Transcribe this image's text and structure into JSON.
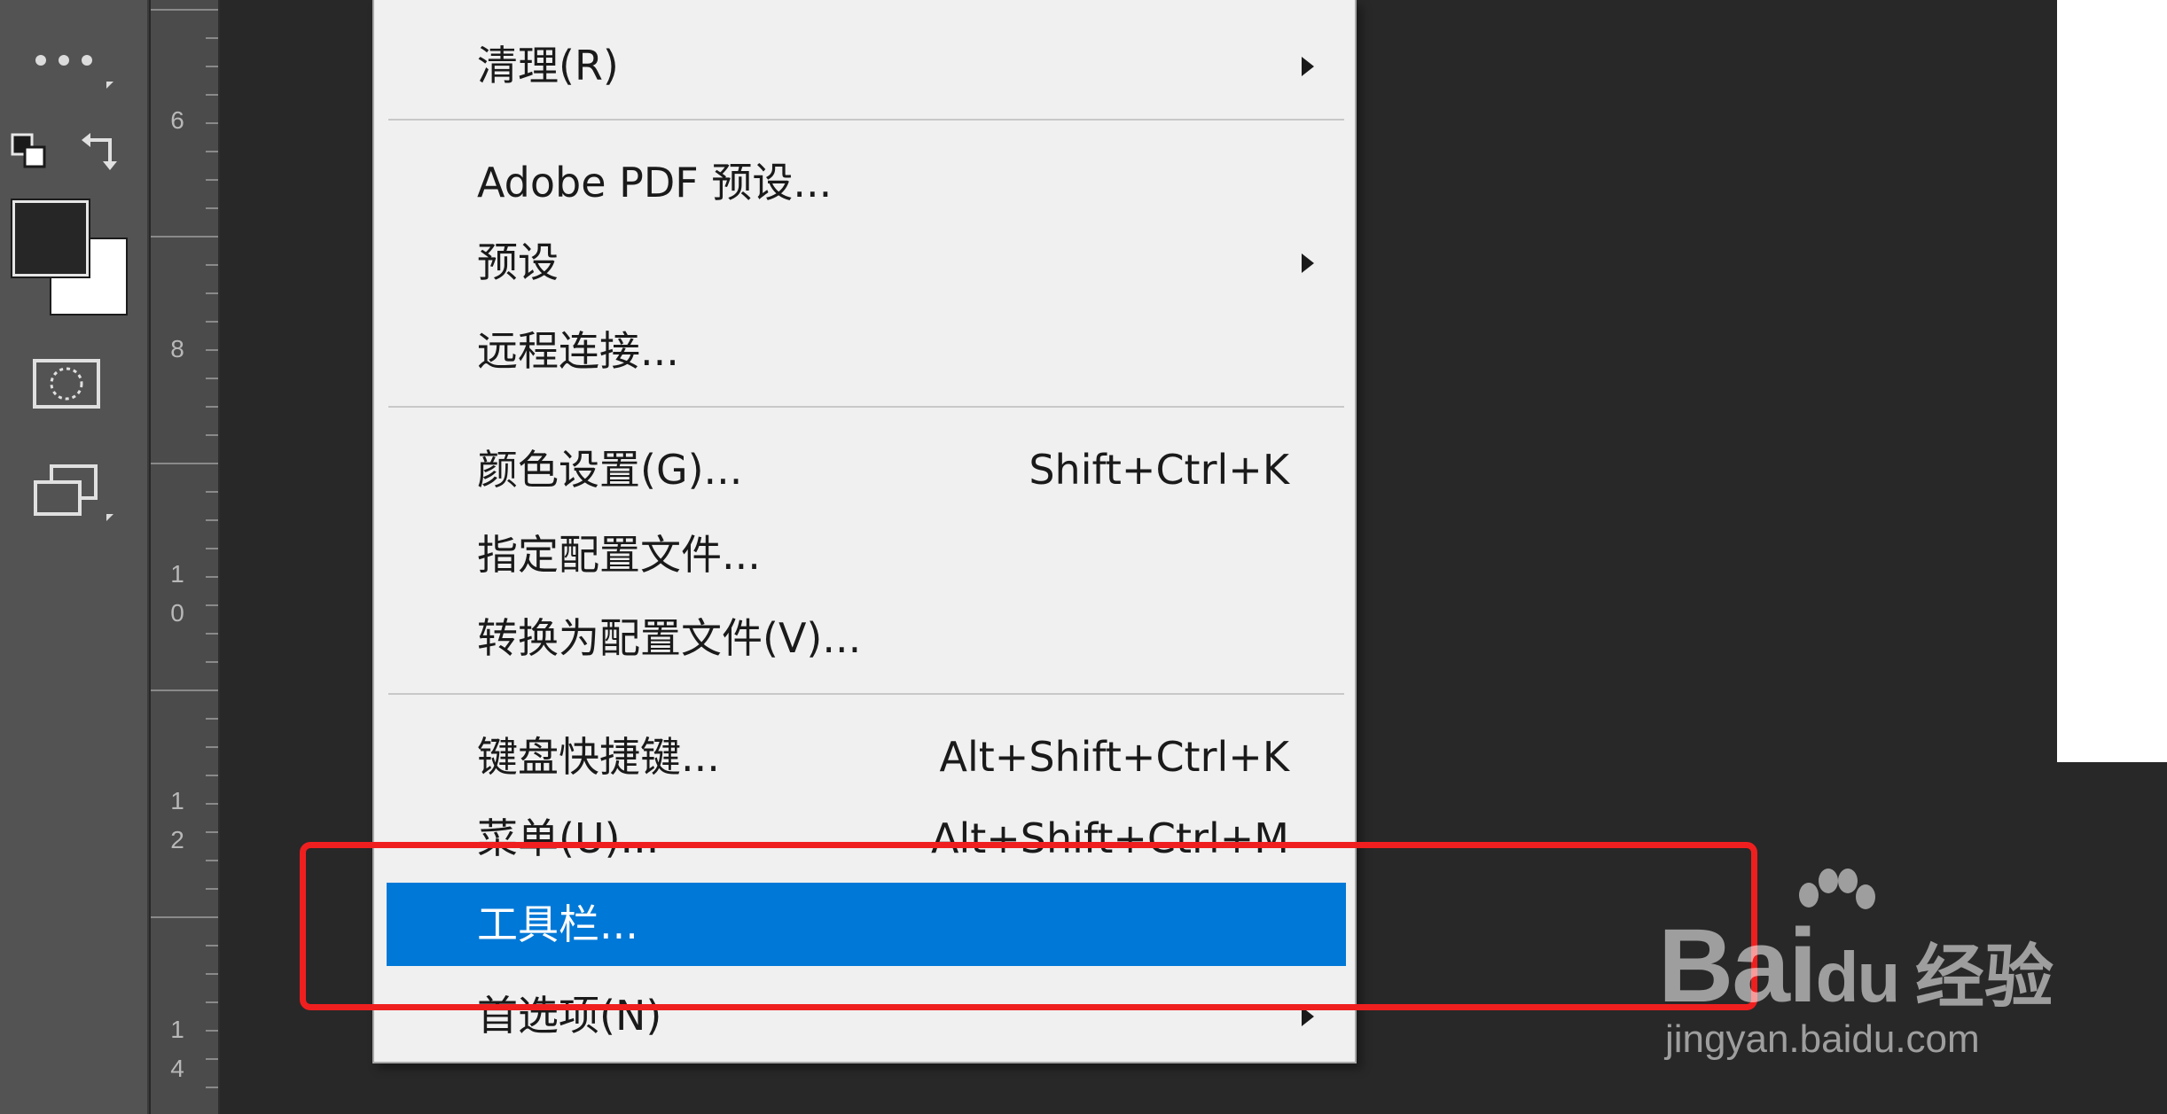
{
  "ruler": {
    "labels": [
      "6",
      "8",
      "1",
      "0",
      "1",
      "2",
      "1",
      "4"
    ]
  },
  "menu": {
    "items": [
      {
        "label": "清理(R)",
        "shortcut": "",
        "submenu": true
      },
      {
        "label": "Adobe PDF 预设...",
        "shortcut": "",
        "submenu": false
      },
      {
        "label": "预设",
        "shortcut": "",
        "submenu": true
      },
      {
        "label": "远程连接...",
        "shortcut": "",
        "submenu": false
      },
      {
        "label": "颜色设置(G)...",
        "shortcut": "Shift+Ctrl+K",
        "submenu": false
      },
      {
        "label": "指定配置文件...",
        "shortcut": "",
        "submenu": false
      },
      {
        "label": "转换为配置文件(V)...",
        "shortcut": "",
        "submenu": false
      },
      {
        "label": "键盘快捷键...",
        "shortcut": "Alt+Shift+Ctrl+K",
        "submenu": false
      },
      {
        "label": "菜单(U)...",
        "shortcut": "Alt+Shift+Ctrl+M",
        "submenu": false
      },
      {
        "label": "工具栏...",
        "shortcut": "",
        "submenu": false,
        "active": true
      },
      {
        "label": "首选项(N)",
        "shortcut": "",
        "submenu": true
      }
    ]
  },
  "colors": {
    "highlight_bg": "#0078d7",
    "annotation_box": "#ef1f1f",
    "menu_bg": "#f0f0f0"
  },
  "watermark": {
    "brand": "Bai",
    "brand_mid": "du",
    "brand_cn": "经验",
    "url": "jingyan.baidu.com"
  }
}
